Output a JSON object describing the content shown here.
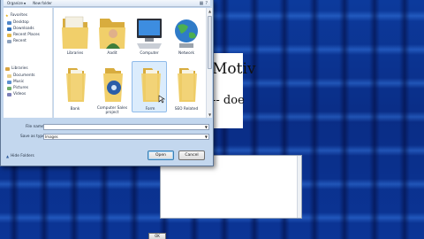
{
  "document": {
    "line1": "Motiv",
    "line2": "-- doe"
  },
  "message_box": {
    "ok_label": "OK"
  },
  "toolbar": {
    "organize_label": "Organize",
    "new_folder_label": "New folder"
  },
  "nav": {
    "favorites_header": "Favorites",
    "favorites": [
      "Desktop",
      "Downloads",
      "Recent Places",
      "Recent"
    ],
    "libraries_header": "Libraries",
    "libraries": [
      "Documents",
      "Music",
      "Pictures",
      "Videos"
    ]
  },
  "tiles": [
    {
      "label": "Libraries",
      "icon": "libraries-folder-icon"
    },
    {
      "label": "Aadit",
      "icon": "user-folder-icon"
    },
    {
      "label": "Computer",
      "icon": "computer-icon"
    },
    {
      "label": "Network",
      "icon": "network-globe-icon"
    },
    {
      "label": "Bank",
      "icon": "folder-icon"
    },
    {
      "label": "Computer Sales project",
      "icon": "folder-icon"
    },
    {
      "label": "Form",
      "icon": "folder-icon"
    },
    {
      "label": "SEO Related",
      "icon": "folder-icon"
    }
  ],
  "form": {
    "file_name_label": "File name:",
    "file_name_value": "",
    "save_type_label": "Save as type:",
    "save_type_value": "Images"
  },
  "buttons": {
    "open": "Open",
    "cancel": "Cancel"
  },
  "hide_folders_label": "Hide Folders",
  "colors": {
    "desktop_background": "#0a2d86",
    "dialog_frame": "#c3d7ee",
    "selection": "#bedcfa",
    "folder": "#f1cf6a"
  }
}
